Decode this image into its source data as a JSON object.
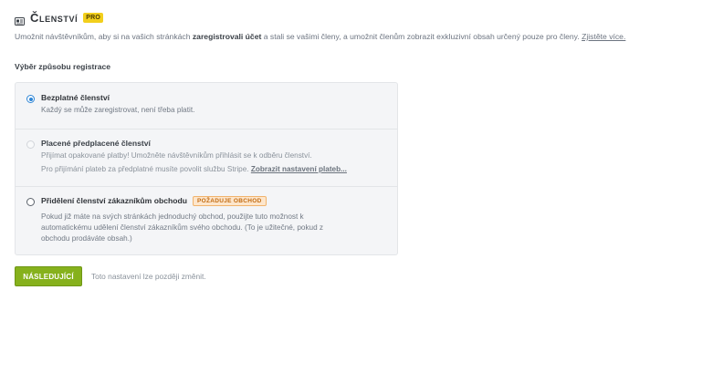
{
  "header": {
    "icon": "membership-card-icon",
    "title": "Členství",
    "badge": "PRO"
  },
  "intro": {
    "before_bold": "Umožnit návštěvníkům, aby si na vašich stránkách ",
    "bold": "zaregistrovali účet",
    "after_bold": " a stali se vašimi členy, a umožnit členům zobrazit exkluzivní obsah určený pouze pro členy. ",
    "link": "Zjistěte více."
  },
  "section_title": "Výběr způsobu registrace",
  "options": [
    {
      "title": "Bezplatné členství",
      "desc": "Každý se může zaregistrovat, není třeba platit.",
      "selected": true
    },
    {
      "title": "Placené předplacené členství",
      "desc": "Přijímat opakované platby! Umožněte návštěvníkům přihlásit se k odběru členství.",
      "note": "Pro přijímání plateb za předplatné musíte povolit službu Stripe. ",
      "note_link": "Zobrazit nastavení plateb...",
      "selected": false,
      "disabled": true
    },
    {
      "title": "Přidělení členství zákazníkům obchodu",
      "badge": "POŽADUJE OBCHOD",
      "desc_lines": [
        "Pokud již máte na svých stránkách jednoduchý obchod, použijte tuto možnost k",
        "automatickému udělení členství zákazníkům svého obchodu. (To je užitečné, pokud z",
        "obchodu prodáváte obsah.)"
      ],
      "selected": false
    }
  ],
  "next_button": "NÁSLEDUJÍCÍ",
  "hint": "Toto nastavení lze později změnit.",
  "colors": {
    "accent_green": "#86b11c",
    "radio_blue": "#2f86d6",
    "pro_badge": "#f2cf1c",
    "store_badge_bg": "#fde6cc",
    "store_badge_text": "#c26b11"
  }
}
